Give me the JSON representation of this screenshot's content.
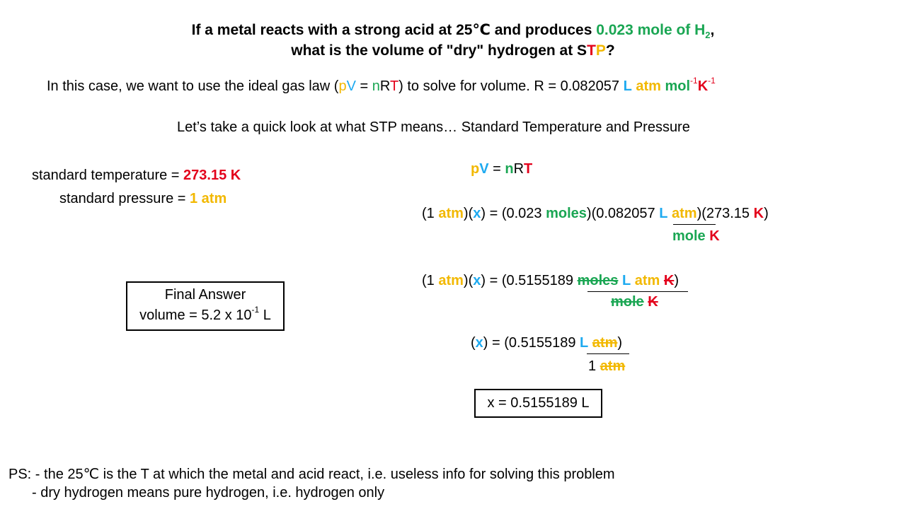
{
  "title": {
    "line1_a": "If a metal reacts with a strong acid at 25",
    "degc": "℃",
    "line1_b": " and produces ",
    "line1_green": "0.023 mole of H",
    "sub2": "2",
    "comma": ",",
    "line2_a": "what is the volume of \"dry\" hydrogen at S",
    "line2_T": "T",
    "line2_P": "P",
    "line2_q": "?"
  },
  "intro": {
    "a": "In this case, we want to use the ideal gas law (",
    "p": "p",
    "V": "V",
    "eq": " = ",
    "n": "n",
    "R": "R",
    "T": "T",
    "b": ") to solve for volume. R = 0.082057 ",
    "L": "L",
    "atm": "atm",
    "mol": "mol",
    "sup1": "-1",
    "K": "K",
    "sup2": "-1"
  },
  "stp_line": "Let’s take a quick look at what STP means… Standard Temperature and Pressure",
  "standards": {
    "temp_label": "standard temperature = ",
    "temp_value": "273.15 K",
    "pres_label": "standard pressure = ",
    "pres_value": "1 atm"
  },
  "final_box": {
    "heading": "Final Answer",
    "value_a": "volume = 5.2 x 10",
    "exp": "-1",
    "unit": " L"
  },
  "eq1": {
    "p": "p",
    "V": "V",
    "eq": " = ",
    "n": "n",
    "R": "R",
    "T": "T"
  },
  "eq2": {
    "open": "(1 ",
    "atm": "atm",
    "close": ")(",
    "x": "x",
    "mid": ") = (0.023 ",
    "moles": "moles",
    "mid2": ")(0.082057 ",
    "L": "L",
    "atm2": "atm",
    "end": ")(273.15 ",
    "K": "K",
    "end2": ")",
    "den_mole": "mole",
    "den_K": "K"
  },
  "eq3": {
    "open": "(1 ",
    "atm": "atm",
    "close": ")(",
    "x": "x",
    "mid": ") = (0.5155189 ",
    "moles": "moles",
    "L": "L",
    "atm2": "atm",
    "K": "K",
    "end": ")",
    "den_mole": "mole",
    "den_K": "K"
  },
  "eq4": {
    "open": "(",
    "x": "x",
    "mid": ") = (0.5155189 ",
    "L": "L",
    "atm": "atm",
    "end": ")",
    "den_1": "1 ",
    "den_atm": "atm"
  },
  "answer_box": "x = 0.5155189 L",
  "ps": {
    "line1": "PS: - the 25℃ is the T at which the metal and acid react, i.e. useless info for solving this problem",
    "line2": "- dry hydrogen means pure hydrogen, i.e. hydrogen only"
  },
  "colors": {
    "orange": "#f2b800",
    "blue": "#1eaaf0",
    "green": "#1aa653",
    "red": "#e3001b"
  }
}
